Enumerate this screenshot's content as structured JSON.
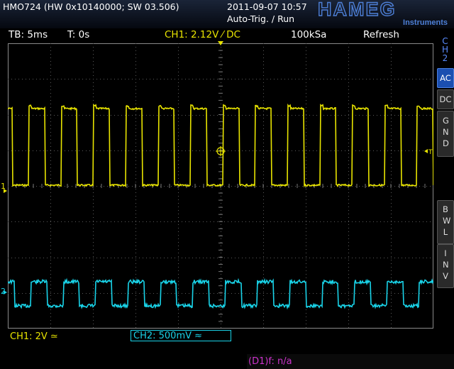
{
  "header": {
    "device": "HMO724 (HW 0x10140000; SW 03.506)",
    "timestamp": "2011-09-07 10:57",
    "trigger_mode": "Auto-Trig. / Run",
    "brand": "HAMEG",
    "brand_sub": "Instruments"
  },
  "status": {
    "timebase": "TB: 5ms",
    "time_offset": "T: 0s",
    "ch1_trigger": "CH1: 2.12V ⁄ DC",
    "sample_rate": "100kSa",
    "acq_mode": "Refresh"
  },
  "sidebar": {
    "channel": [
      "C",
      "H",
      "2"
    ],
    "buttons": [
      {
        "label": "AC",
        "active": true
      },
      {
        "label": "DC",
        "active": false
      },
      {
        "label": "GND",
        "active": false
      },
      {
        "label": "BWL",
        "active": false
      },
      {
        "label": "INV",
        "active": false
      }
    ]
  },
  "footer": {
    "ch1": "CH1: 2V ≃",
    "ch2": "CH2: 500mV ≈",
    "math": "(D1)f: n/a"
  },
  "markers": {
    "ch1_marker": "1",
    "ch2_marker": "2",
    "trigger_marker": "T"
  },
  "colors": {
    "ch1": "#e8e400",
    "ch2": "#19d3e8",
    "grid": "#5a5a5a",
    "accent": "#1b4fb0",
    "math": "#cc33cc"
  }
}
